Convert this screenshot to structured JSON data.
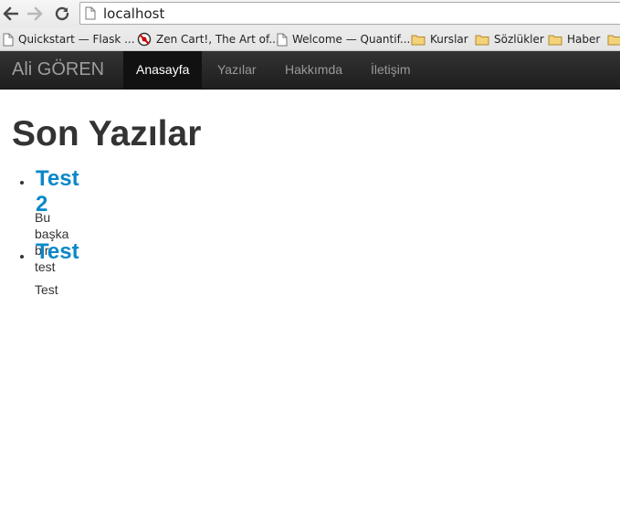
{
  "browser": {
    "url": "localhost",
    "bookmarks": [
      {
        "label": "Quickstart — Flask ...",
        "icon": "page-icon"
      },
      {
        "label": "Zen Cart!, The Art of...",
        "icon": "zencart-icon"
      },
      {
        "label": "Welcome — Quantif...",
        "icon": "page-icon"
      },
      {
        "label": "Kurslar",
        "icon": "folder-icon"
      },
      {
        "label": "Sözlükler",
        "icon": "folder-icon"
      },
      {
        "label": "Haber",
        "icon": "folder-icon"
      }
    ]
  },
  "site": {
    "brand": "Ali GÖREN",
    "nav": [
      "Anasayfa",
      "Yazılar",
      "Hakkımda",
      "İletişim"
    ],
    "active_nav": "Anasayfa"
  },
  "main": {
    "title": "Son Yazılar",
    "posts": [
      {
        "title": "Test 2",
        "body": "Bu başka bir test"
      },
      {
        "title": "Test",
        "body": "Test"
      }
    ]
  },
  "colors": {
    "link": "#0a88c9",
    "navbar": "#222222",
    "text": "#333333"
  }
}
